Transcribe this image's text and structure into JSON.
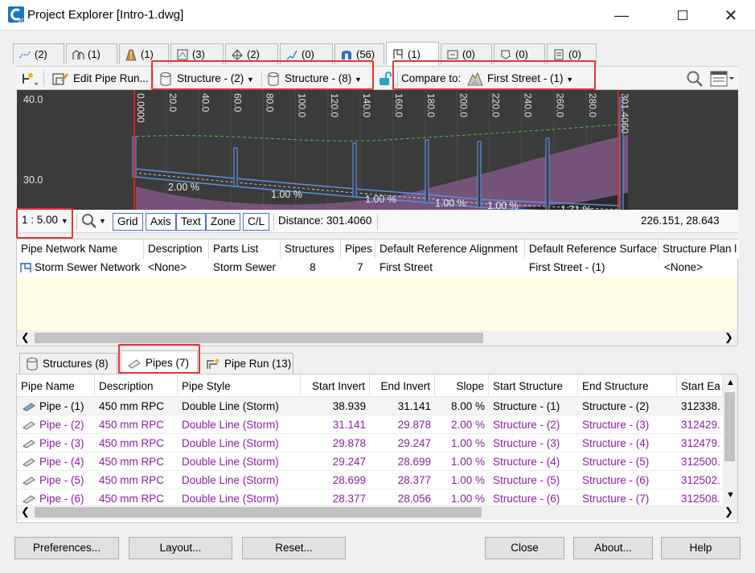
{
  "window": {
    "title": "Project Explorer [Intro-1.dwg]"
  },
  "top_tabs": [
    {
      "label": "(2)",
      "icon": "alignment-icon"
    },
    {
      "label": "(1)",
      "icon": "sites-icon"
    },
    {
      "label": "(1)",
      "icon": "profile-view-icon"
    },
    {
      "label": "(3)",
      "icon": "sections-icon"
    },
    {
      "label": "(2)",
      "icon": "surfaces-icon"
    },
    {
      "label": "(0)",
      "icon": "feature-line-icon"
    },
    {
      "label": "(56)",
      "icon": "corridor-icon"
    },
    {
      "label": "(1)",
      "icon": "pipe-network-icon"
    },
    {
      "label": "(0)",
      "icon": "pressure-network-icon"
    },
    {
      "label": "(0)",
      "icon": "parcel-icon"
    },
    {
      "label": "(0)",
      "icon": "sheets-icon"
    }
  ],
  "toolbar": {
    "edit_pipe_run": "Edit Pipe Run...",
    "structure_from": "Structure - (2)",
    "structure_to": "Structure - (8)",
    "compare_label": "Compare to:",
    "compare_value": "First Street - (1)"
  },
  "profile": {
    "y_labels": [
      "40.0",
      "30.0"
    ],
    "stations": [
      "0.0000",
      "20.0",
      "40.0",
      "60.0",
      "80.0",
      "100.0",
      "120.0",
      "140.0",
      "160.0",
      "180.0",
      "200.0",
      "220.0",
      "240.0",
      "260.0",
      "280.0",
      "301.4060"
    ],
    "slopes": [
      "2.00 %",
      "1.00 %",
      "1.00 %",
      "1.00 %",
      "1.00 %",
      "1.71 %"
    ]
  },
  "zoombar": {
    "scale": "1 : 5.00",
    "buttons": [
      "Grid",
      "Axis",
      "Text",
      "Zone",
      "C/L"
    ],
    "distance": "Distance: 301.4060",
    "coords": "226.151, 28.643"
  },
  "network_grid": {
    "columns": [
      "Pipe Network Name",
      "Description",
      "Parts List",
      "Structures",
      "Pipes",
      "Default Reference Alignment",
      "Default Reference Surface",
      "Structure Plan l"
    ],
    "row": [
      "Storm Sewer Network",
      "<None>",
      "Storm Sewer",
      "8",
      "7",
      "First Street",
      "First Street - (1)",
      "<None>"
    ]
  },
  "bottom_tabs": [
    {
      "label": "Structures (8)",
      "icon": "structure-icon"
    },
    {
      "label": "Pipes (7)",
      "icon": "pipe-icon"
    },
    {
      "label": "Pipe Run (13)",
      "icon": "pipe-run-icon"
    }
  ],
  "pipes": {
    "columns": [
      "Pipe Name",
      "Description",
      "Pipe Style",
      "Start Invert",
      "End Invert",
      "Slope",
      "Start Structure",
      "End Structure",
      "Start Ea"
    ],
    "rows": [
      [
        "Pipe - (1)",
        "450 mm RPC",
        "Double Line (Storm)",
        "38.939",
        "31.141",
        "8.00 %",
        "Structure - (1)",
        "Structure - (2)",
        "312338."
      ],
      [
        "Pipe - (2)",
        "450 mm RPC",
        "Double Line (Storm)",
        "31.141",
        "29.878",
        "2.00 %",
        "Structure - (2)",
        "Structure - (3)",
        "312429."
      ],
      [
        "Pipe - (3)",
        "450 mm RPC",
        "Double Line (Storm)",
        "29.878",
        "29.247",
        "1.00 %",
        "Structure - (3)",
        "Structure - (4)",
        "312479."
      ],
      [
        "Pipe - (4)",
        "450 mm RPC",
        "Double Line (Storm)",
        "29.247",
        "28.699",
        "1.00 %",
        "Structure - (4)",
        "Structure - (5)",
        "312500."
      ],
      [
        "Pipe - (5)",
        "450 mm RPC",
        "Double Line (Storm)",
        "28.699",
        "28.377",
        "1.00 %",
        "Structure - (5)",
        "Structure - (6)",
        "312502."
      ],
      [
        "Pipe - (6)",
        "450 mm RPC",
        "Double Line (Storm)",
        "28.377",
        "28.056",
        "1.00 %",
        "Structure - (6)",
        "Structure - (7)",
        "312508."
      ]
    ]
  },
  "footer": {
    "preferences": "Preferences...",
    "layout": "Layout...",
    "reset": "Reset...",
    "close": "Close",
    "about": "About...",
    "help": "Help"
  },
  "colors": {
    "highlight": "#e03636",
    "purple_row": "#8b1fa0",
    "profile_bg": "#3b3b3b",
    "pipe_blue": "#5b8fe0"
  }
}
